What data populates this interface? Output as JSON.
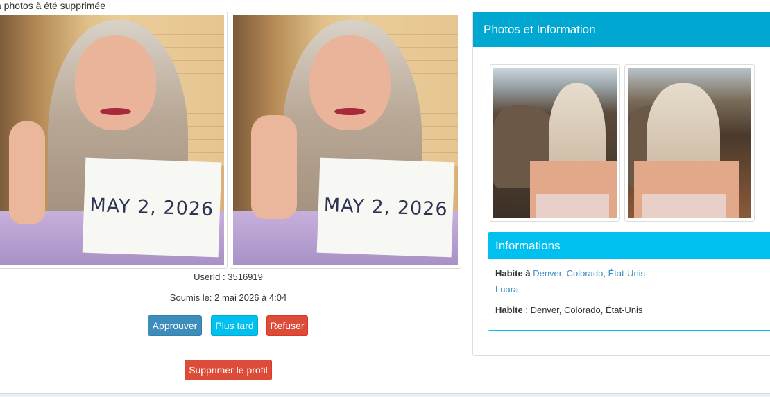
{
  "notice": "a photos à été supprimée",
  "verification": {
    "photos": [
      {
        "sign_text": "MAY 2, 2026",
        "gesture": "one finger"
      },
      {
        "sign_text": "MAY 2, 2026",
        "gesture": "peace sign"
      }
    ],
    "userid_text": "UserId : 3516919",
    "submitted_text": "Soumis le: 2 mai 2026 à 4:04"
  },
  "actions": {
    "approve": "Approuver",
    "later": "Plus tard",
    "refuse": "Refuser",
    "delete_profile": "Supprimer le profil"
  },
  "panel": {
    "title": "Photos et Information",
    "thumbnails": [
      "profile-photo-1",
      "profile-photo-2"
    ],
    "info": {
      "title": "Informations",
      "lives_in_label": "Habite à",
      "lives_in_value": "Denver, Colorado, État-Unis",
      "name": "Luara",
      "lives_label": "Habite",
      "lives_value": ": Denver, Colorado, État-Unis"
    }
  },
  "colors": {
    "primary": "#3c8dbc",
    "info": "#00c0ef",
    "danger": "#dd4b39",
    "panel_header": "#00a7d0"
  }
}
